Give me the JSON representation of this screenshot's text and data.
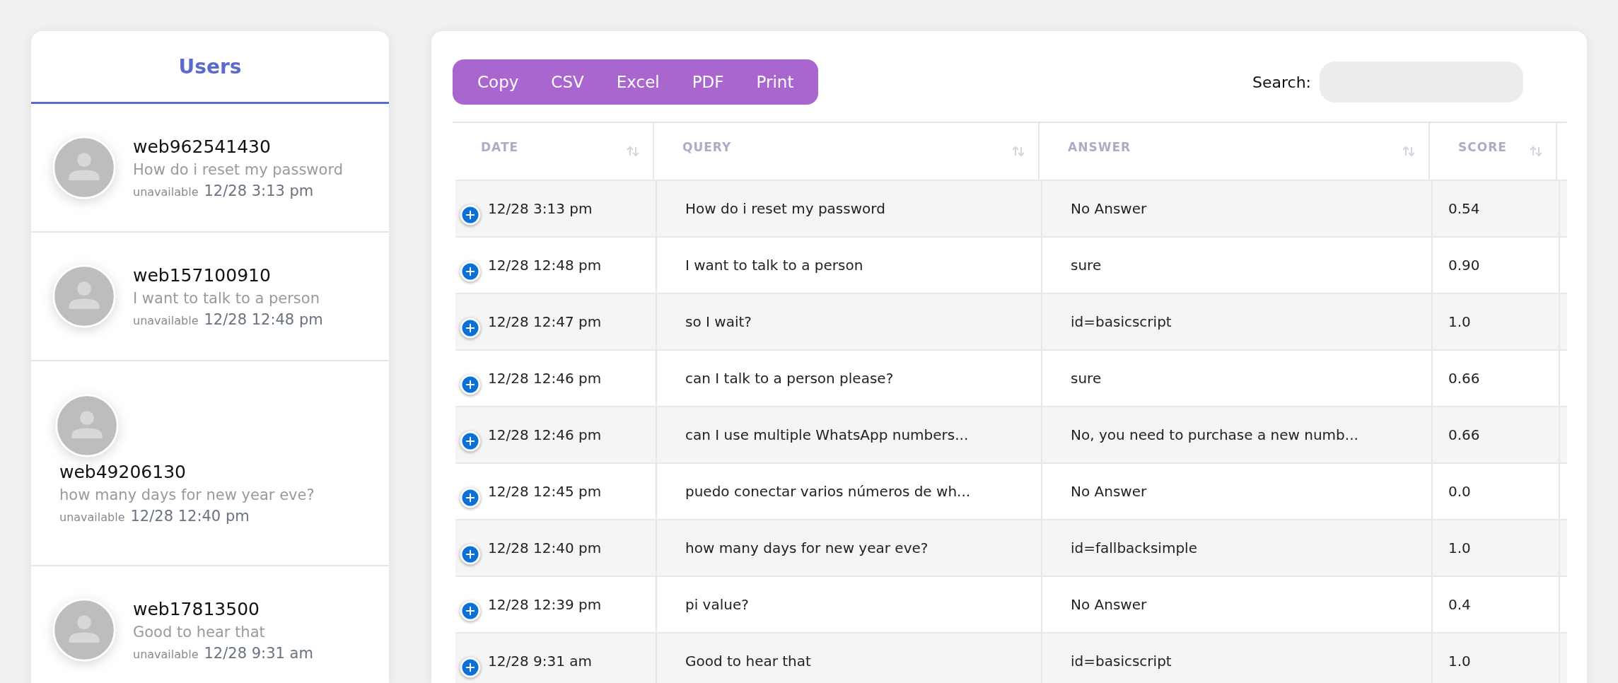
{
  "sidebar": {
    "title": "Users",
    "users": [
      {
        "kind": "inline",
        "name": "web962541430",
        "message": "How do i reset my password",
        "status": "unavailable",
        "time": "12/28 3:13 pm"
      },
      {
        "kind": "inline",
        "name": "web157100910",
        "message": "I want to talk to a person",
        "status": "unavailable",
        "time": "12/28 12:48 pm"
      },
      {
        "kind": "stacked",
        "name": "web49206130",
        "message": "how many days for new year eve?",
        "status": "unavailable",
        "time": "12/28 12:40 pm"
      },
      {
        "kind": "inline",
        "name": "web17813500",
        "message": "Good to hear that",
        "status": "unavailable",
        "time": "12/28 9:31 am"
      }
    ]
  },
  "toolbar": {
    "buttons": [
      "Copy",
      "CSV",
      "Excel",
      "PDF",
      "Print"
    ],
    "search": {
      "label": "Search:"
    }
  },
  "table": {
    "columns": [
      "DATE",
      "QUERY",
      "ANSWER",
      "SCORE"
    ],
    "rows": [
      [
        "12/28 3:13 pm",
        "How do i reset my password",
        "No Answer",
        "0.54"
      ],
      [
        "12/28 12:48 pm",
        "I want to talk to a person",
        "sure",
        "0.90"
      ],
      [
        "12/28 12:47 pm",
        "so I wait?",
        "id=basicscript",
        "1.0"
      ],
      [
        "12/28 12:46 pm",
        "can I talk to a person please?",
        "sure",
        "0.66"
      ],
      [
        "12/28 12:46 pm",
        "can I use multiple WhatsApp numbers...",
        "No, you need to purchase a new numb...",
        "0.66"
      ],
      [
        "12/28 12:45 pm",
        "puedo conectar varios números de wh...",
        "No Answer",
        "0.0"
      ],
      [
        "12/28 12:40 pm",
        "how many days for new year eve?",
        "id=fallbacksimple",
        "1.0"
      ],
      [
        "12/28 12:39 pm",
        "pi value?",
        "No Answer",
        "0.4"
      ],
      [
        "12/28 9:31 am",
        "Good to hear that",
        "id=basicscript",
        "1.0"
      ]
    ]
  }
}
